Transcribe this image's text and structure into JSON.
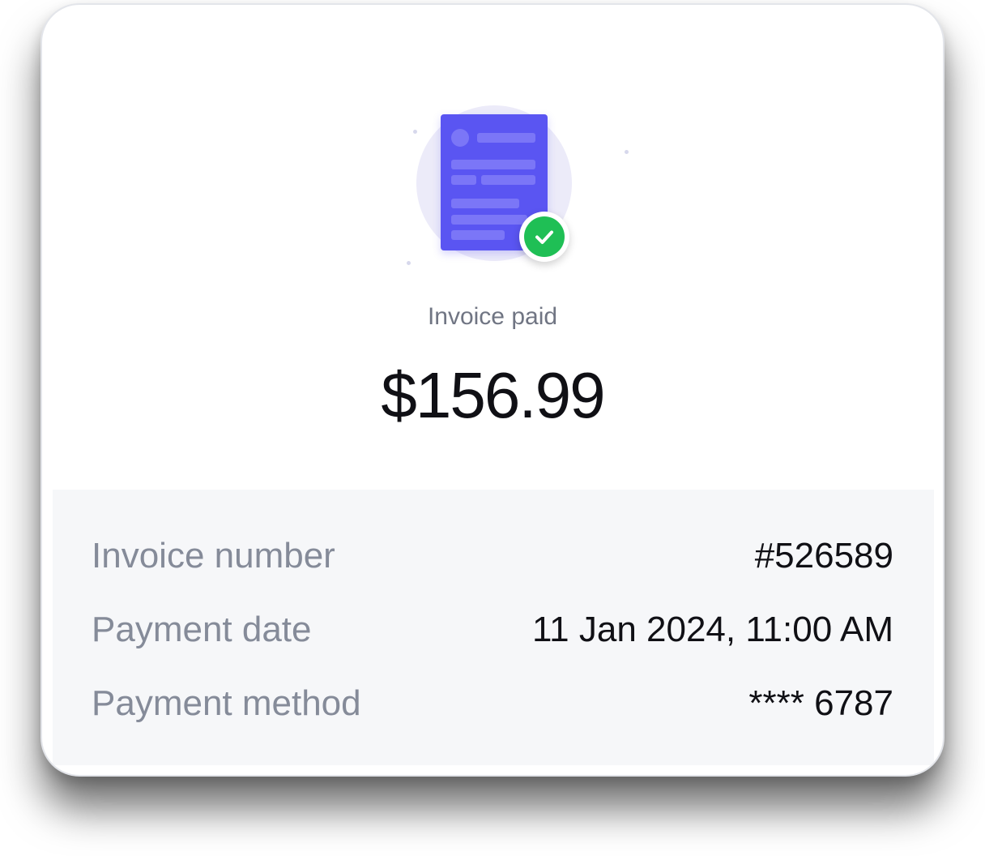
{
  "receipt": {
    "status_label": "Invoice paid",
    "amount": "$156.99",
    "illustration_icon": "invoice-document-icon",
    "badge_icon": "check-icon",
    "details": [
      {
        "label": "Invoice number",
        "value": "#526589"
      },
      {
        "label": "Payment date",
        "value": "11 Jan 2024, 11:00 AM"
      },
      {
        "label": "Payment method",
        "value": "**** 6787"
      }
    ]
  },
  "colors": {
    "document": "#5a55f2",
    "document_lines": "#7b76f7",
    "halo": "#ecebf9",
    "success": "#1fbf55",
    "muted_text": "#707583",
    "detail_label": "#858b99",
    "primary_text": "#101015",
    "details_background": "#f6f7f9"
  }
}
